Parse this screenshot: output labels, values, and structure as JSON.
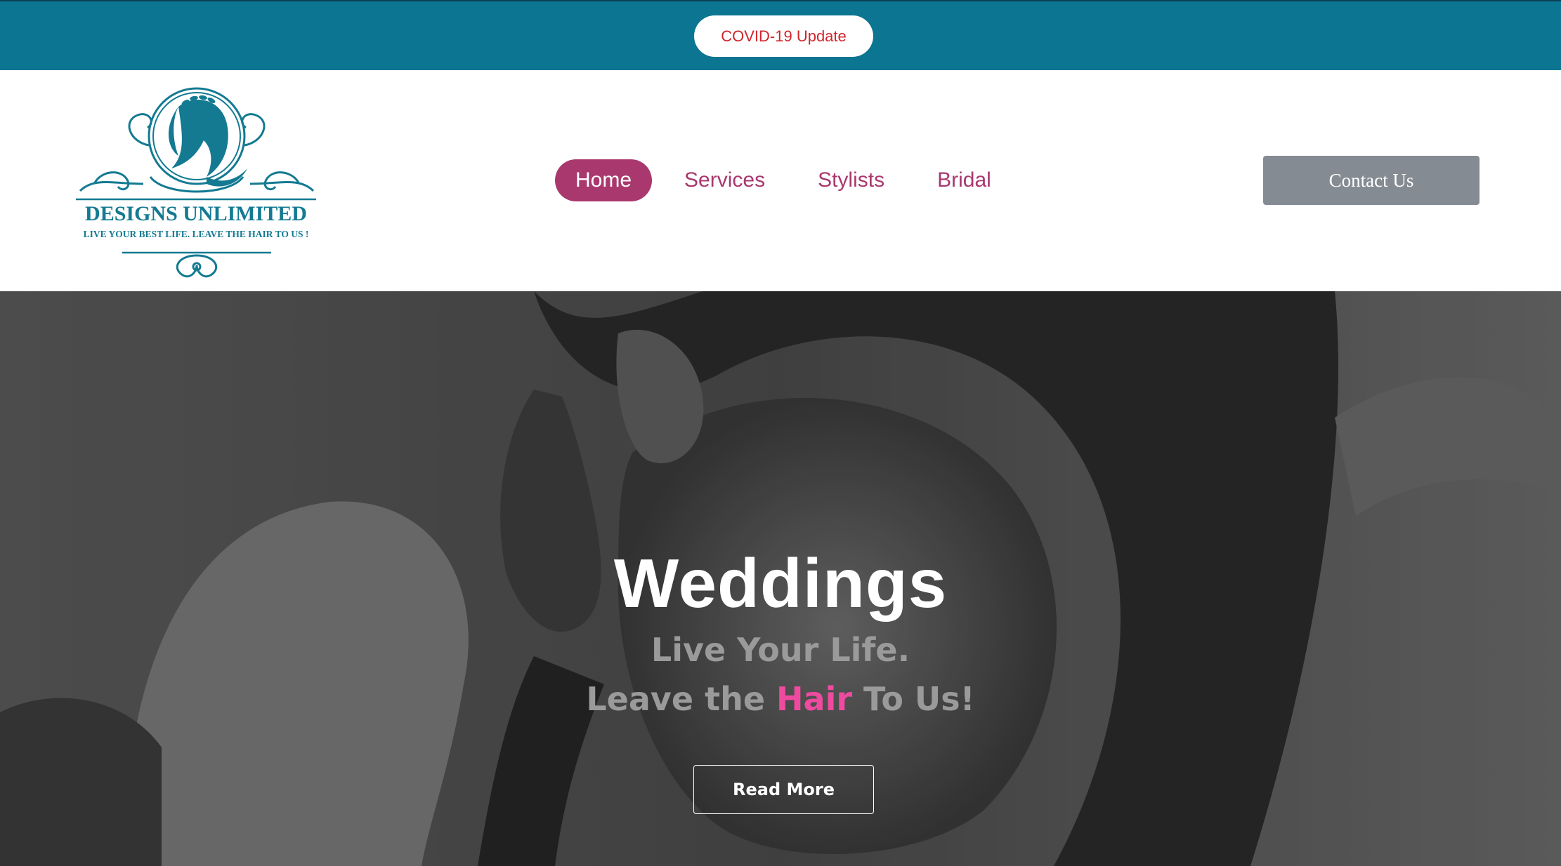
{
  "topbar": {
    "covid_button": "COVID-19 Update"
  },
  "logo": {
    "name": "DESIGNS UNLIMITED",
    "tagline": "LIVE YOUR BEST LIFE. LEAVE THE HAIR TO US !"
  },
  "nav": {
    "items": [
      {
        "label": "Home",
        "active": true
      },
      {
        "label": "Services",
        "active": false
      },
      {
        "label": "Stylists",
        "active": false
      },
      {
        "label": "Bridal",
        "active": false
      }
    ]
  },
  "contact_button": "Contact Us",
  "hero": {
    "title": "Weddings",
    "line1": "Live Your Life.",
    "line2_before": "Leave the ",
    "line2_highlight": "Hair",
    "line2_after": " To Us!",
    "button": "Read More"
  },
  "colors": {
    "topbar": "#0b7592",
    "accent": "#a9386e",
    "covid_text": "#d0262c",
    "contact_button": "#858b92",
    "hair_highlight": "#ef4aa0",
    "logo_teal": "#137a92"
  }
}
